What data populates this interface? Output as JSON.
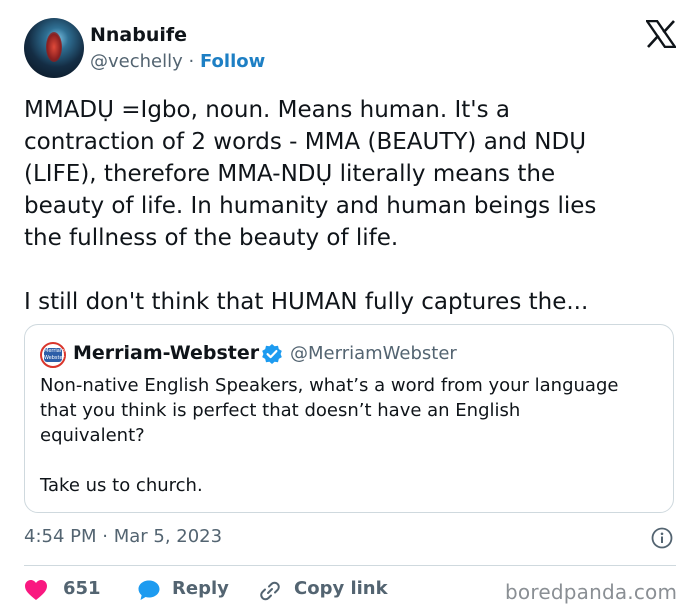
{
  "author": {
    "display_name": "Nnabuife",
    "handle": "@vechelly",
    "separator": "·",
    "follow_label": "Follow"
  },
  "tweet": {
    "text": "MMADỤ =Igbo, noun. Means human. It's a\ncontraction of 2 words - MMA (BEAUTY) and NDỤ\n(LIFE), therefore MMA-NDỤ literally means the\nbeauty of life. In humanity and human beings lies\nthe fullness of the beauty of life.\n\nI still don't think that HUMAN fully captures the..."
  },
  "quoted": {
    "display_name": "Merriam-Webster",
    "handle": "@MerriamWebster",
    "avatar_text": "Merriam-Webster",
    "text": "Non-native English Speakers, what’s a word from your language\nthat you think is perfect that doesn’t have an English\nequivalent?\n\nTake us to church."
  },
  "meta": {
    "time": "4:54 PM · Mar 5, 2023"
  },
  "actions": {
    "like_count": "651",
    "reply_label": "Reply",
    "copy_label": "Copy link"
  },
  "watermark": "boredpanda.com",
  "colors": {
    "like": "#f91880",
    "reply": "#1d9bf0",
    "follow": "#1d7fc4",
    "verified": "#1d9bf0"
  },
  "icons": [
    "x-logo-icon",
    "verified-badge-icon",
    "info-icon",
    "heart-icon",
    "reply-bubble-icon",
    "link-icon"
  ]
}
